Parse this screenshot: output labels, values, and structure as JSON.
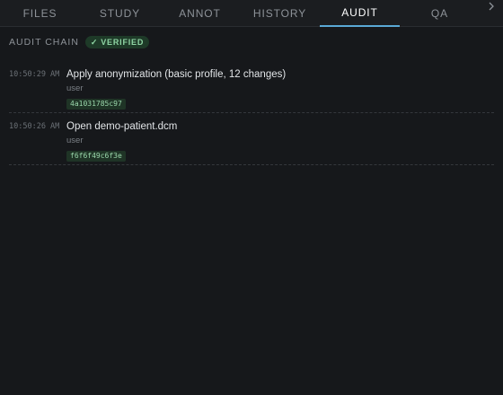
{
  "tabs": [
    {
      "label": "FILES",
      "active": false
    },
    {
      "label": "STUDY",
      "active": false
    },
    {
      "label": "ANNOT",
      "active": false
    },
    {
      "label": "HISTORY",
      "active": false
    },
    {
      "label": "AUDIT",
      "active": true
    },
    {
      "label": "QA",
      "active": false
    }
  ],
  "tab_overflow_icon": "chevron-right-icon",
  "audit": {
    "title": "AUDIT CHAIN",
    "badge_check": "✓",
    "badge_label": "VERIFIED",
    "entries": [
      {
        "time": "10:50:29 AM",
        "action": "Apply anonymization (basic profile, 12 changes)",
        "actor": "user",
        "hash": "4a1031785c97"
      },
      {
        "time": "10:50:26 AM",
        "action": "Open demo-patient.dcm",
        "actor": "user",
        "hash": "f6f6f49c6f3e"
      }
    ]
  },
  "colors": {
    "background": "#16181b",
    "accent": "#5aa9d6",
    "verified": "#8fd5a4"
  }
}
